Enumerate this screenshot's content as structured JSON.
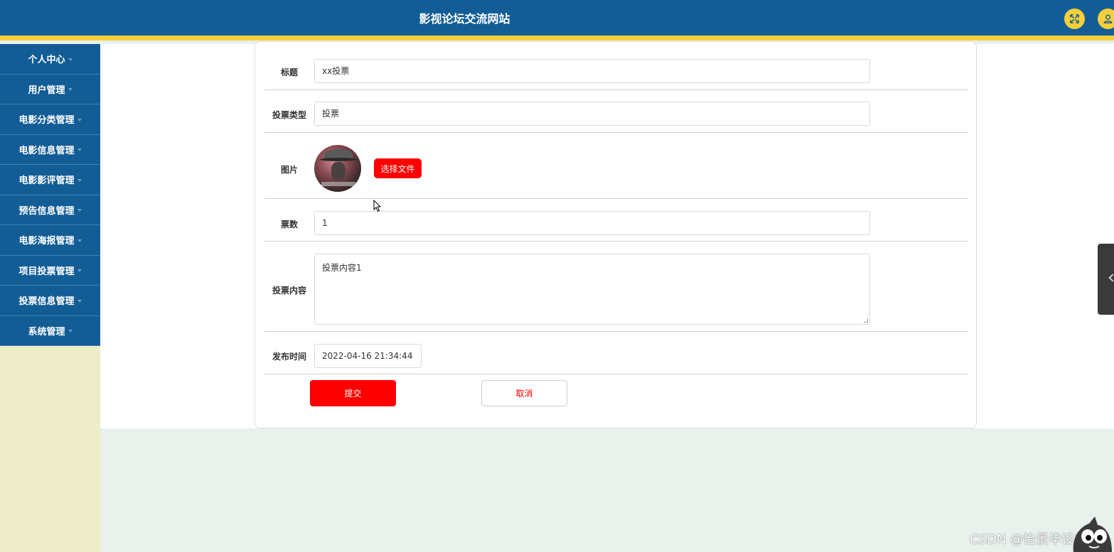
{
  "header": {
    "title": "影视论坛交流网站",
    "fullscreen_icon": "fullscreen-icon",
    "user_icon": "user-icon",
    "accent_color": "#135d96",
    "stripe_color": "#f7cf3b"
  },
  "sidebar": {
    "items": [
      {
        "label": "个人中心"
      },
      {
        "label": "用户管理"
      },
      {
        "label": "电影分类管理"
      },
      {
        "label": "电影信息管理"
      },
      {
        "label": "电影影评管理"
      },
      {
        "label": "预告信息管理"
      },
      {
        "label": "电影海报管理"
      },
      {
        "label": "项目投票管理"
      },
      {
        "label": "投票信息管理"
      },
      {
        "label": "系统管理"
      }
    ]
  },
  "form": {
    "title_label": "标题",
    "title_value": "xx投票",
    "type_label": "投票类型",
    "type_value": "投票",
    "image_label": "图片",
    "choose_file_label": "选择文件",
    "votes_label": "票数",
    "votes_value": "1",
    "content_label": "投票内容",
    "content_value": "投票内容1",
    "time_label": "发布时间",
    "time_value": "2022-04-16 21:34:44",
    "submit_label": "提交",
    "cancel_label": "取消",
    "button_color": "#ff0000"
  },
  "watermark": {
    "text": "CSDN @怡景毕设项目"
  }
}
